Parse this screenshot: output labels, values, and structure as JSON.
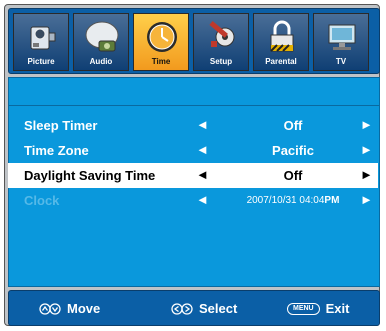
{
  "tabs": [
    {
      "label": "Picture",
      "icon": "camcorder-icon"
    },
    {
      "label": "Audio",
      "icon": "speaker-icon"
    },
    {
      "label": "Time",
      "icon": "clock-icon"
    },
    {
      "label": "Setup",
      "icon": "wrench-gear-icon"
    },
    {
      "label": "Parental",
      "icon": "padlock-icon"
    },
    {
      "label": "TV",
      "icon": "monitor-icon"
    }
  ],
  "active_tab": "Time",
  "menu": {
    "rows": [
      {
        "name": "Sleep Timer",
        "value": "Off"
      },
      {
        "name": "Time Zone",
        "value": "Pacific"
      },
      {
        "name": "Daylight Saving Time",
        "value": "Off"
      },
      {
        "name": "Clock",
        "value": "2007/10/31 04:04",
        "value_suffix": "PM"
      }
    ]
  },
  "footer": {
    "move_label": "Move",
    "select_label": "Select",
    "menu_key": "MENU",
    "exit_label": "Exit"
  },
  "colors": {
    "panel": "#0a98dc",
    "bar": "#0b5fa6",
    "active_tab": "#f6a623"
  }
}
